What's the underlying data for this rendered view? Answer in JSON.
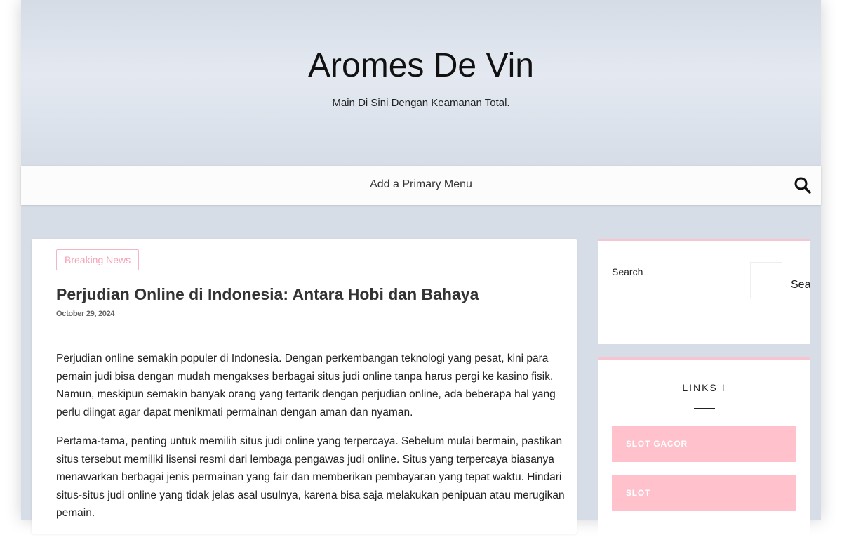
{
  "site": {
    "title": "Aromes De Vin",
    "description": "Main Di Sini Dengan Keamanan Total."
  },
  "nav": {
    "menu_label": "Add a Primary Menu",
    "search_icon": "search-icon"
  },
  "article": {
    "category": "Breaking News",
    "title": "Perjudian Online di Indonesia: Antara Hobi dan Bahaya",
    "date": "October 29, 2024",
    "paragraphs": [
      "Perjudian online semakin populer di Indonesia. Dengan perkembangan teknologi yang pesat, kini para pemain judi bisa dengan mudah mengakses berbagai situs judi online tanpa harus pergi ke kasino fisik. Namun, meskipun semakin banyak orang yang tertarik dengan perjudian online, ada beberapa hal yang perlu diingat agar dapat menikmati permainan dengan aman dan nyaman.",
      "Pertama-tama, penting untuk memilih situs judi online yang terpercaya. Sebelum mulai bermain, pastikan situs tersebut memiliki lisensi resmi dari lembaga pengawas judi online. Situs yang terpercaya biasanya menawarkan berbagai jenis permainan yang fair dan memberikan pembayaran yang tepat waktu. Hindari situs-situs judi online yang tidak jelas asal usulnya, karena bisa saja melakukan penipuan atau merugikan pemain."
    ]
  },
  "sidebar": {
    "search": {
      "label": "Search",
      "placeholder": "",
      "button_label": "Search"
    },
    "links": {
      "title": "LINKS I",
      "items": [
        {
          "label": "SLOT GACOR"
        },
        {
          "label": "SLOT"
        }
      ]
    }
  },
  "colors": {
    "accent_pink": "#ffc1cc",
    "badge_pink": "#f4a2b5",
    "background": "#d6dde7"
  }
}
